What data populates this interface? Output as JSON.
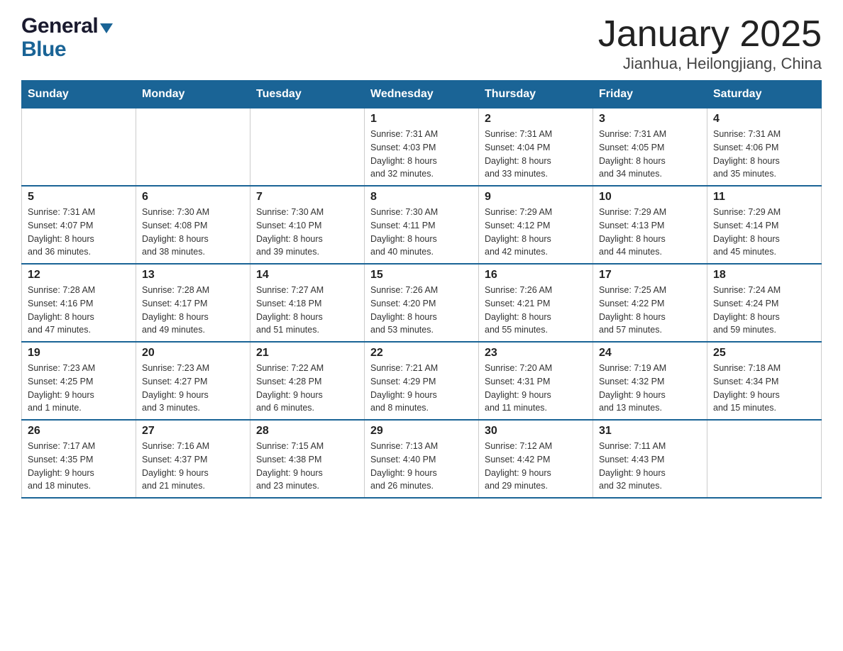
{
  "header": {
    "logo_general": "General",
    "logo_blue": "Blue",
    "title": "January 2025",
    "subtitle": "Jianhua, Heilongjiang, China"
  },
  "calendar": {
    "days": [
      "Sunday",
      "Monday",
      "Tuesday",
      "Wednesday",
      "Thursday",
      "Friday",
      "Saturday"
    ],
    "weeks": [
      [
        {
          "day": "",
          "info": ""
        },
        {
          "day": "",
          "info": ""
        },
        {
          "day": "",
          "info": ""
        },
        {
          "day": "1",
          "info": "Sunrise: 7:31 AM\nSunset: 4:03 PM\nDaylight: 8 hours\nand 32 minutes."
        },
        {
          "day": "2",
          "info": "Sunrise: 7:31 AM\nSunset: 4:04 PM\nDaylight: 8 hours\nand 33 minutes."
        },
        {
          "day": "3",
          "info": "Sunrise: 7:31 AM\nSunset: 4:05 PM\nDaylight: 8 hours\nand 34 minutes."
        },
        {
          "day": "4",
          "info": "Sunrise: 7:31 AM\nSunset: 4:06 PM\nDaylight: 8 hours\nand 35 minutes."
        }
      ],
      [
        {
          "day": "5",
          "info": "Sunrise: 7:31 AM\nSunset: 4:07 PM\nDaylight: 8 hours\nand 36 minutes."
        },
        {
          "day": "6",
          "info": "Sunrise: 7:30 AM\nSunset: 4:08 PM\nDaylight: 8 hours\nand 38 minutes."
        },
        {
          "day": "7",
          "info": "Sunrise: 7:30 AM\nSunset: 4:10 PM\nDaylight: 8 hours\nand 39 minutes."
        },
        {
          "day": "8",
          "info": "Sunrise: 7:30 AM\nSunset: 4:11 PM\nDaylight: 8 hours\nand 40 minutes."
        },
        {
          "day": "9",
          "info": "Sunrise: 7:29 AM\nSunset: 4:12 PM\nDaylight: 8 hours\nand 42 minutes."
        },
        {
          "day": "10",
          "info": "Sunrise: 7:29 AM\nSunset: 4:13 PM\nDaylight: 8 hours\nand 44 minutes."
        },
        {
          "day": "11",
          "info": "Sunrise: 7:29 AM\nSunset: 4:14 PM\nDaylight: 8 hours\nand 45 minutes."
        }
      ],
      [
        {
          "day": "12",
          "info": "Sunrise: 7:28 AM\nSunset: 4:16 PM\nDaylight: 8 hours\nand 47 minutes."
        },
        {
          "day": "13",
          "info": "Sunrise: 7:28 AM\nSunset: 4:17 PM\nDaylight: 8 hours\nand 49 minutes."
        },
        {
          "day": "14",
          "info": "Sunrise: 7:27 AM\nSunset: 4:18 PM\nDaylight: 8 hours\nand 51 minutes."
        },
        {
          "day": "15",
          "info": "Sunrise: 7:26 AM\nSunset: 4:20 PM\nDaylight: 8 hours\nand 53 minutes."
        },
        {
          "day": "16",
          "info": "Sunrise: 7:26 AM\nSunset: 4:21 PM\nDaylight: 8 hours\nand 55 minutes."
        },
        {
          "day": "17",
          "info": "Sunrise: 7:25 AM\nSunset: 4:22 PM\nDaylight: 8 hours\nand 57 minutes."
        },
        {
          "day": "18",
          "info": "Sunrise: 7:24 AM\nSunset: 4:24 PM\nDaylight: 8 hours\nand 59 minutes."
        }
      ],
      [
        {
          "day": "19",
          "info": "Sunrise: 7:23 AM\nSunset: 4:25 PM\nDaylight: 9 hours\nand 1 minute."
        },
        {
          "day": "20",
          "info": "Sunrise: 7:23 AM\nSunset: 4:27 PM\nDaylight: 9 hours\nand 3 minutes."
        },
        {
          "day": "21",
          "info": "Sunrise: 7:22 AM\nSunset: 4:28 PM\nDaylight: 9 hours\nand 6 minutes."
        },
        {
          "day": "22",
          "info": "Sunrise: 7:21 AM\nSunset: 4:29 PM\nDaylight: 9 hours\nand 8 minutes."
        },
        {
          "day": "23",
          "info": "Sunrise: 7:20 AM\nSunset: 4:31 PM\nDaylight: 9 hours\nand 11 minutes."
        },
        {
          "day": "24",
          "info": "Sunrise: 7:19 AM\nSunset: 4:32 PM\nDaylight: 9 hours\nand 13 minutes."
        },
        {
          "day": "25",
          "info": "Sunrise: 7:18 AM\nSunset: 4:34 PM\nDaylight: 9 hours\nand 15 minutes."
        }
      ],
      [
        {
          "day": "26",
          "info": "Sunrise: 7:17 AM\nSunset: 4:35 PM\nDaylight: 9 hours\nand 18 minutes."
        },
        {
          "day": "27",
          "info": "Sunrise: 7:16 AM\nSunset: 4:37 PM\nDaylight: 9 hours\nand 21 minutes."
        },
        {
          "day": "28",
          "info": "Sunrise: 7:15 AM\nSunset: 4:38 PM\nDaylight: 9 hours\nand 23 minutes."
        },
        {
          "day": "29",
          "info": "Sunrise: 7:13 AM\nSunset: 4:40 PM\nDaylight: 9 hours\nand 26 minutes."
        },
        {
          "day": "30",
          "info": "Sunrise: 7:12 AM\nSunset: 4:42 PM\nDaylight: 9 hours\nand 29 minutes."
        },
        {
          "day": "31",
          "info": "Sunrise: 7:11 AM\nSunset: 4:43 PM\nDaylight: 9 hours\nand 32 minutes."
        },
        {
          "day": "",
          "info": ""
        }
      ]
    ]
  }
}
